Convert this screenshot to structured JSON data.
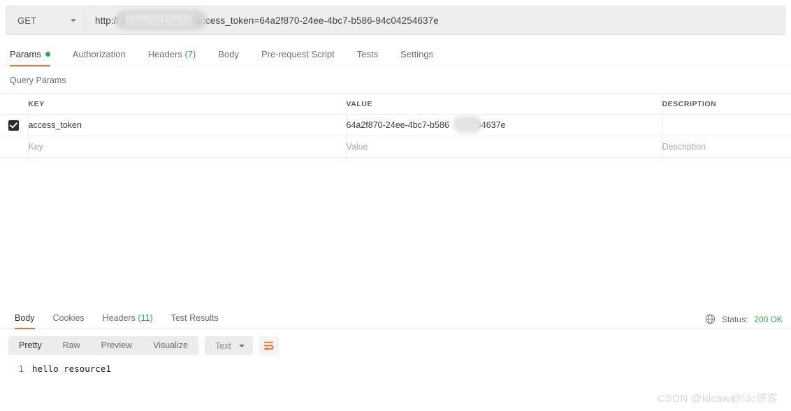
{
  "request": {
    "method": "GET",
    "url": "http://                 /resource1/hello?access_token=64a2f870-24ee-4bc7-b586-94c04254637e",
    "url_prefix": "http:/",
    "url_suffix": "/resource1/hello?access_token=64a2f870-24ee-4bc7-b586-94c04254637e",
    "tabs": [
      {
        "label": "Params",
        "dot": true,
        "active": true
      },
      {
        "label": "Authorization",
        "active": false
      },
      {
        "label": "Headers",
        "count": "(7)",
        "active": false
      },
      {
        "label": "Body",
        "active": false
      },
      {
        "label": "Pre-request Script",
        "active": false
      },
      {
        "label": "Tests",
        "active": false
      },
      {
        "label": "Settings",
        "active": false
      }
    ]
  },
  "query_params": {
    "title": "Query Params",
    "columns": {
      "key": "KEY",
      "value": "VALUE",
      "description": "DESCRIPTION"
    },
    "rows": [
      {
        "checked": true,
        "key": "access_token",
        "value_left": "64a2f870-24ee-4bc7-b586",
        "value_right": "4254637e",
        "description": ""
      }
    ],
    "placeholders": {
      "key": "Key",
      "value": "Value",
      "description": "Description"
    }
  },
  "response": {
    "tabs": [
      {
        "label": "Body",
        "active": true
      },
      {
        "label": "Cookies",
        "active": false
      },
      {
        "label": "Headers",
        "count": "(11)",
        "active": false
      },
      {
        "label": "Test Results",
        "active": false
      }
    ],
    "status_label": "Status:",
    "status_value": "200 OK",
    "view_modes": [
      {
        "label": "Pretty",
        "active": true
      },
      {
        "label": "Raw",
        "active": false
      },
      {
        "label": "Preview",
        "active": false
      },
      {
        "label": "Visualize",
        "active": false
      }
    ],
    "format": "Text",
    "body_lines": [
      {
        "number": "1",
        "text": "hello resource1"
      }
    ]
  },
  "watermark": {
    "main": "CSDN @ldcaws",
    "overlap": "@ldc博客"
  },
  "colors": {
    "accent": "#ef6c33",
    "success": "#2cab42",
    "text": "#3c3c3c"
  }
}
